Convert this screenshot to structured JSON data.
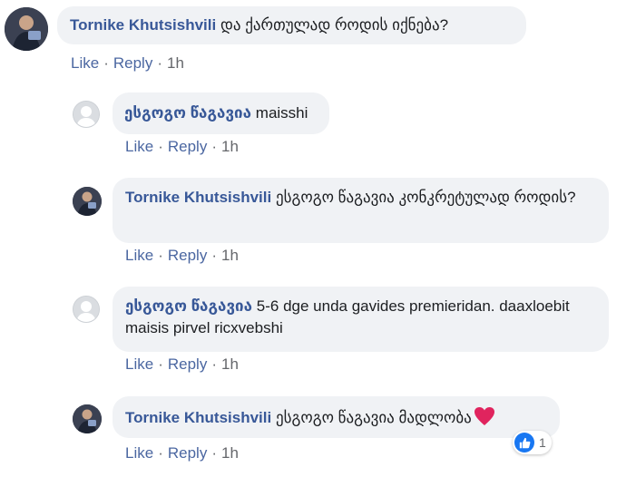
{
  "actions": {
    "like": "Like",
    "reply": "Reply",
    "dot": "·"
  },
  "comments": [
    {
      "author": "Tornike Khutsishvili",
      "text": "და ქართულად როდის იქნება?",
      "time": "1h",
      "avatar": "photo"
    },
    {
      "author": "ესგოგო წაგავია",
      "text": "maisshi",
      "time": "1h",
      "avatar": "default-user-icon"
    },
    {
      "author": "Tornike Khutsishvili",
      "text": "ესგოგო წაგავია კონკრეტულად როდის?",
      "time": "1h",
      "avatar": "photo"
    },
    {
      "author": "ესგოგო წაგავია",
      "text": "5-6 dge unda gavides premieridan. daaxloebit maisis pirvel ricxvebshi",
      "time": "1h",
      "avatar": "default-user-icon"
    },
    {
      "author": "Tornike Khutsishvili",
      "text": "ესგოგო წაგავია მადლობა",
      "time": "1h",
      "avatar": "photo",
      "emoji": "red-heart-icon",
      "reactions": {
        "type": "like-icon",
        "count": "1"
      }
    }
  ],
  "colors": {
    "bubble": "#f0f2f5",
    "author": "#385898",
    "meta": "#65676b",
    "like_blue": "#1877f2",
    "heart": "#e0245e"
  }
}
